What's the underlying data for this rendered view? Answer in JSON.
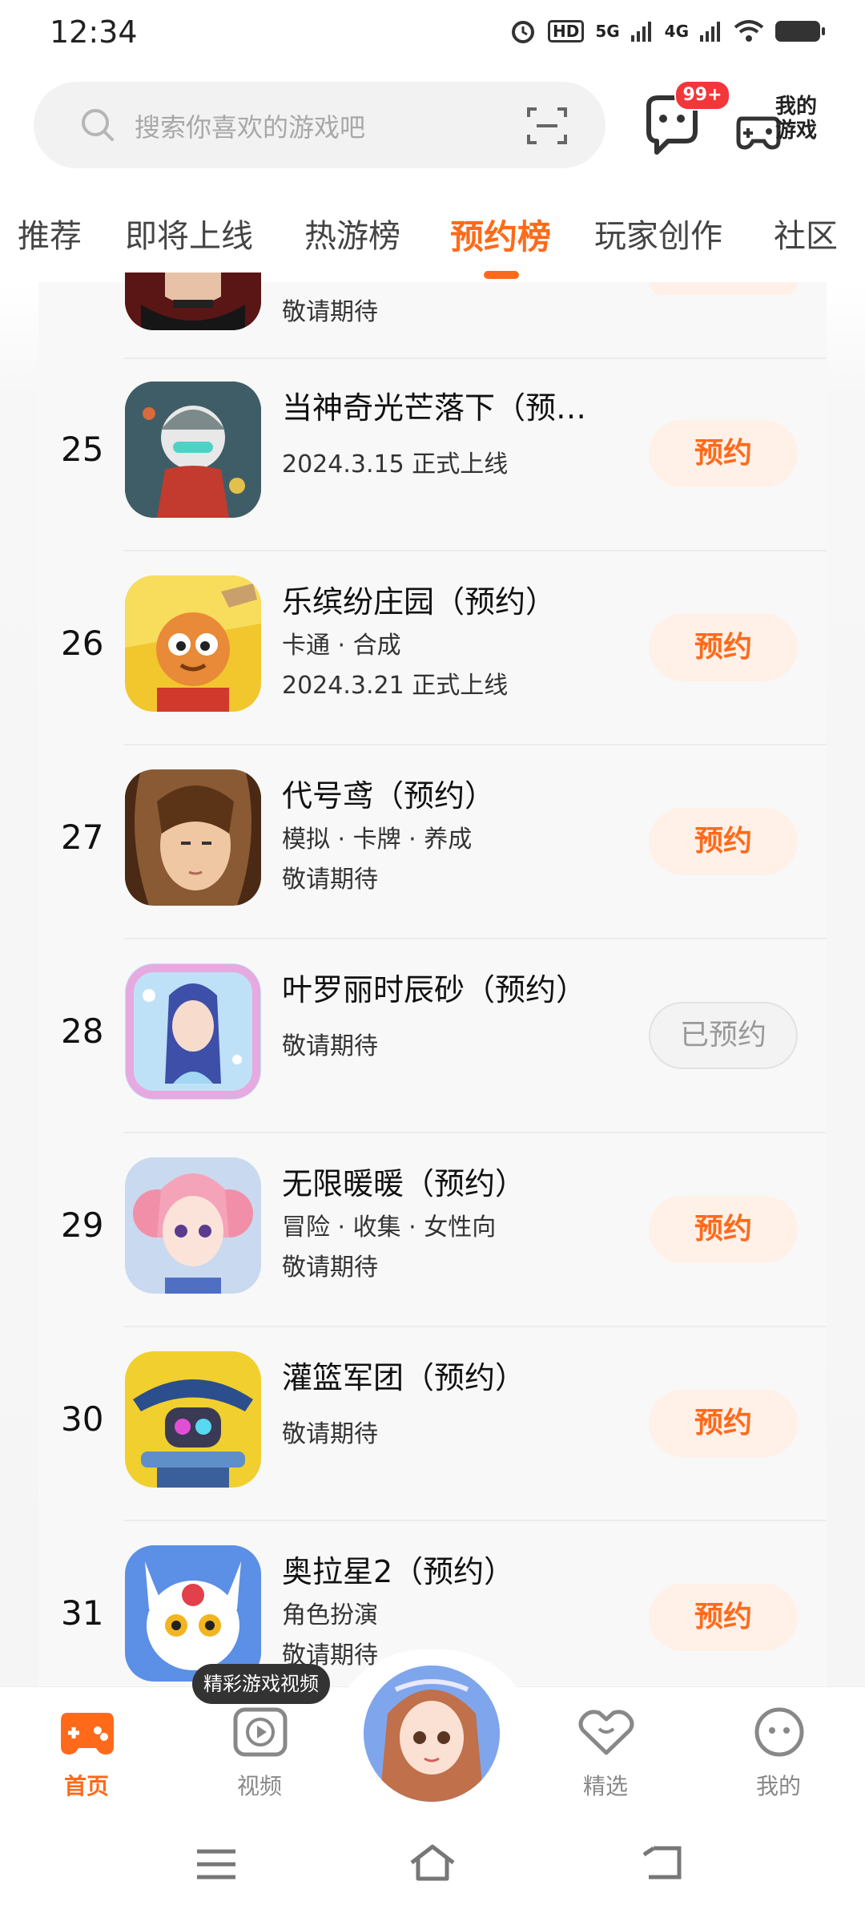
{
  "status_bar": {
    "time": "12:34",
    "hd_label": "HD",
    "net1": "5G",
    "net2": "4G"
  },
  "search": {
    "placeholder": "搜索你喜欢的游戏吧"
  },
  "header": {
    "message_badge": "99+",
    "my_games_label": "我的游戏"
  },
  "tabs": [
    {
      "label": "推荐",
      "active": false
    },
    {
      "label": "即将上线",
      "active": false
    },
    {
      "label": "热游榜",
      "active": false
    },
    {
      "label": "预约榜",
      "active": true
    },
    {
      "label": "玩家创作",
      "active": false
    },
    {
      "label": "社区",
      "active": false
    }
  ],
  "partial_row": {
    "status": "敬请期待"
  },
  "games": [
    {
      "rank": "25",
      "title": "当神奇光芒落下（预…",
      "tags": "",
      "status": "2024.3.15 正式上线",
      "button": "预约",
      "reserved": false
    },
    {
      "rank": "26",
      "title": "乐缤纷庄园（预约）",
      "tags": "卡通 · 合成",
      "status": "2024.3.21 正式上线",
      "button": "预约",
      "reserved": false
    },
    {
      "rank": "27",
      "title": "代号鸢（预约）",
      "tags": "模拟 · 卡牌 · 养成",
      "status": "敬请期待",
      "button": "预约",
      "reserved": false
    },
    {
      "rank": "28",
      "title": "叶罗丽时辰砂（预约）",
      "tags": "",
      "status": "敬请期待",
      "button": "已预约",
      "reserved": true
    },
    {
      "rank": "29",
      "title": "无限暖暖（预约）",
      "tags": "冒险 · 收集 · 女性向",
      "status": "敬请期待",
      "button": "预约",
      "reserved": false
    },
    {
      "rank": "30",
      "title": "灌篮军团（预约）",
      "tags": "",
      "status": "敬请期待",
      "button": "预约",
      "reserved": false
    },
    {
      "rank": "31",
      "title": "奥拉星2（预约）",
      "tags": "角色扮演",
      "status": "敬请期待",
      "button": "预约",
      "reserved": false
    }
  ],
  "tooltip": "精彩游戏视频",
  "bottom_nav": [
    {
      "label": "首页",
      "icon": "gamepad-icon",
      "active": true
    },
    {
      "label": "视频",
      "icon": "video-icon",
      "active": false
    },
    {
      "label": "精选",
      "icon": "heart-icon",
      "active": false
    },
    {
      "label": "我的",
      "icon": "face-icon",
      "active": false
    }
  ],
  "colors": {
    "accent": "#ff6a1a",
    "button_bg": "#fff0e8",
    "badge": "#f3363a"
  }
}
